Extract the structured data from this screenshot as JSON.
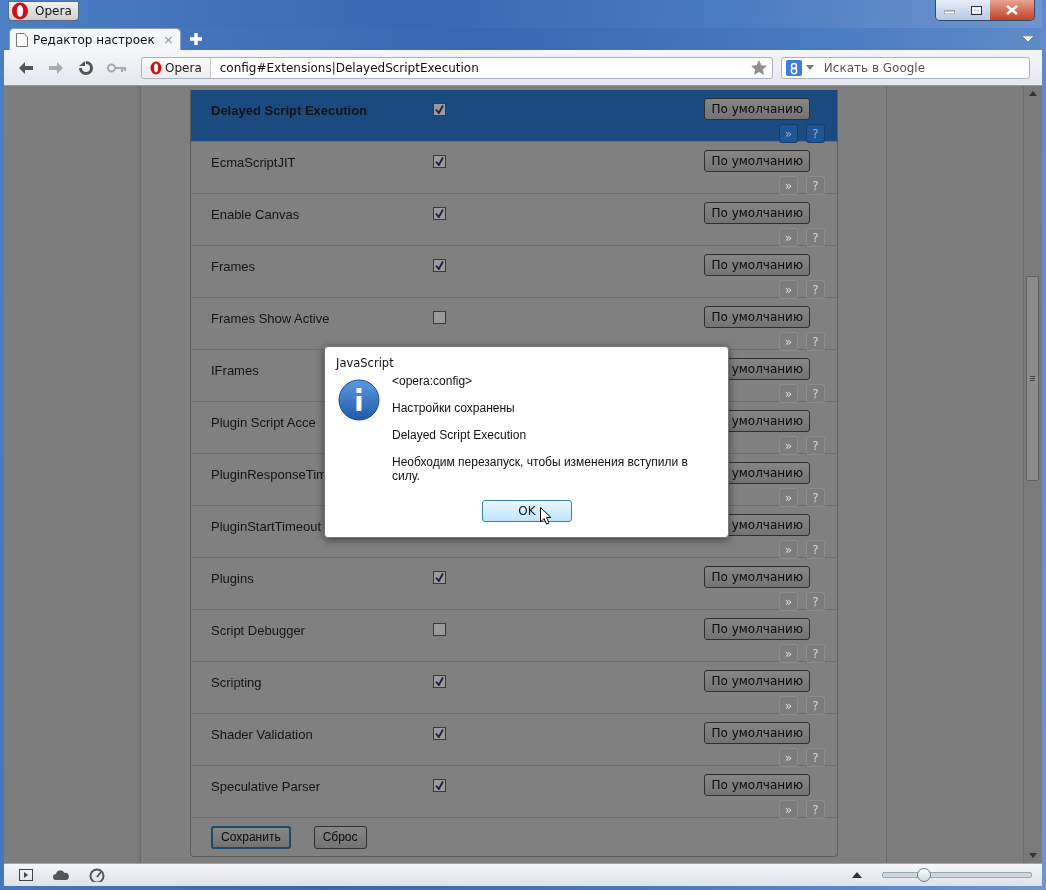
{
  "window": {
    "menu_button": "Opera"
  },
  "tabs": [
    {
      "title": "Редактор настроек",
      "selected": true,
      "close": "×"
    }
  ],
  "toolbar": {
    "site_badge": "Opera",
    "address": "config#Extensions|DelayedScriptExecution",
    "search_placeholder": "Искать в Google"
  },
  "settings": [
    {
      "name": "Delayed Script Execution",
      "checked": true,
      "selected": true,
      "default_button": "По умолчанию",
      "more": "»",
      "help": "?"
    },
    {
      "name": "EcmaScriptJIT",
      "checked": true,
      "selected": false,
      "default_button": "По умолчанию",
      "more": "»",
      "help": "?"
    },
    {
      "name": "Enable Canvas",
      "checked": true,
      "selected": false,
      "default_button": "По умолчанию",
      "more": "»",
      "help": "?"
    },
    {
      "name": "Frames",
      "checked": true,
      "selected": false,
      "default_button": "По умолчанию",
      "more": "»",
      "help": "?"
    },
    {
      "name": "Frames Show Active",
      "checked": false,
      "selected": false,
      "default_button": "По умолчанию",
      "more": "»",
      "help": "?"
    },
    {
      "name": "IFrames",
      "selected": false,
      "default_button": "умолчанию",
      "more": "»",
      "help": "?"
    },
    {
      "name": "Plugin Script Acce",
      "selected": false,
      "default_button": "умолчанию",
      "more": "»",
      "help": "?"
    },
    {
      "name": "PluginResponseTim",
      "selected": false,
      "default_button": "умолчанию",
      "more": "»",
      "help": "?"
    },
    {
      "name": "PluginStartTimeout",
      "selected": false,
      "default_button": "умолчанию",
      "more": "»",
      "help": "?"
    },
    {
      "name": "Plugins",
      "checked": true,
      "selected": false,
      "default_button": "По умолчанию",
      "more": "»",
      "help": "?"
    },
    {
      "name": "Script Debugger",
      "checked": false,
      "selected": false,
      "default_button": "По умолчанию",
      "more": "»",
      "help": "?"
    },
    {
      "name": "Scripting",
      "checked": true,
      "selected": false,
      "default_button": "По умолчанию",
      "more": "»",
      "help": "?"
    },
    {
      "name": "Shader Validation",
      "checked": true,
      "selected": false,
      "default_button": "По умолчанию",
      "more": "»",
      "help": "?"
    },
    {
      "name": "Speculative Parser",
      "checked": true,
      "selected": false,
      "default_button": "По умолчанию",
      "more": "»",
      "help": "?"
    }
  ],
  "footer_buttons": [
    {
      "label": "Сохранить",
      "focused": true
    },
    {
      "label": "Сброс",
      "focused": false
    }
  ],
  "dialog": {
    "title": "JavaScript",
    "messages": [
      "<opera:config>",
      "Настройки сохранены",
      "Delayed Script Execution",
      "Необходим перезапуск, чтобы изменения вступили в силу."
    ],
    "button": "OK"
  },
  "status_bar": {
    "zoom_slider": {
      "level": 0.28
    }
  }
}
